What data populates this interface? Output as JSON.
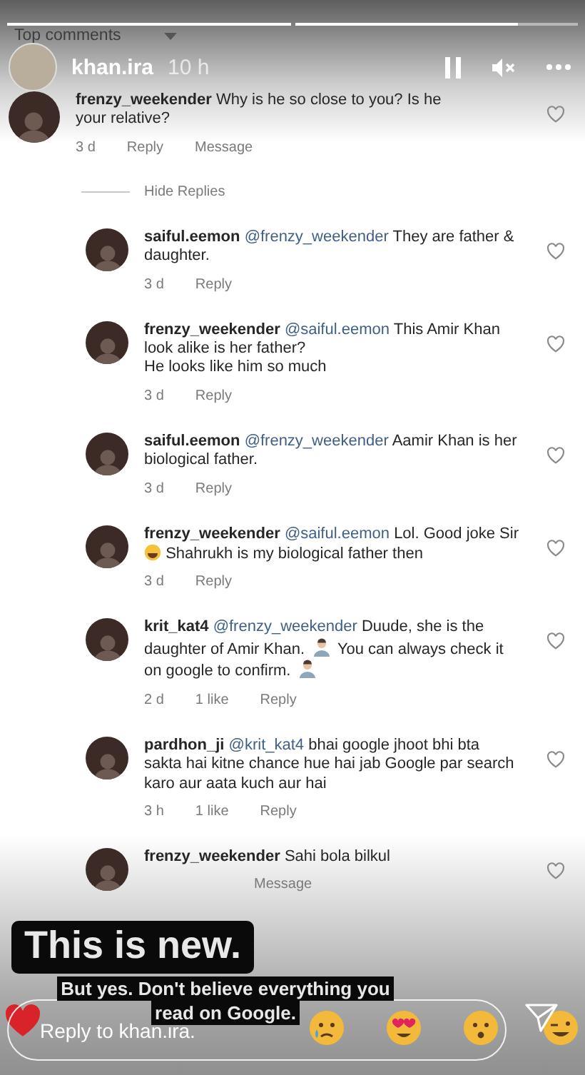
{
  "progress": [
    {
      "level": 1
    },
    {
      "level": 0.79
    }
  ],
  "sort": {
    "label": "Top comments"
  },
  "story": {
    "username": "khan.ira",
    "time": "10 h"
  },
  "comment": {
    "username": "frenzy_weekender",
    "segments": [
      {
        "kind": "text",
        "text": "Why is he so close to you? Is he your relative?"
      }
    ],
    "meta": [
      "3 d",
      "Reply",
      "Message"
    ]
  },
  "hide_replies": "Hide Replies",
  "replies": [
    {
      "username": "saiful.eemon",
      "mention": "@frenzy_weekender",
      "segments": [
        {
          "kind": "text",
          "text": "They are father & daughter."
        }
      ],
      "meta": [
        "3 d",
        "Reply"
      ]
    },
    {
      "username": "frenzy_weekender",
      "mention": "@saiful.eemon",
      "segments": [
        {
          "kind": "text",
          "text": "This Amir Khan look alike is her father?"
        },
        {
          "kind": "break"
        },
        {
          "kind": "text",
          "text": "He looks like him so much"
        }
      ],
      "meta": [
        "3 d",
        "Reply"
      ]
    },
    {
      "username": "saiful.eemon",
      "mention": "@frenzy_weekender",
      "segments": [
        {
          "kind": "text",
          "text": "Aamir Khan is her biological father."
        }
      ],
      "meta": [
        "3 d",
        "Reply"
      ]
    },
    {
      "username": "frenzy_weekender",
      "mention": "@saiful.eemon",
      "segments": [
        {
          "kind": "text",
          "text": "Lol. Good joke Sir"
        },
        {
          "kind": "laugh-emoji"
        },
        {
          "kind": "text",
          "text": "Shahrukh is my biological father then"
        }
      ],
      "meta": [
        "3 d",
        "Reply"
      ]
    },
    {
      "username": "krit_kat4",
      "mention": "@frenzy_weekender",
      "segments": [
        {
          "kind": "text",
          "text": "Duude, she is the daughter of Amir Khan."
        },
        {
          "kind": "person-emoji"
        },
        {
          "kind": "text",
          "text": "You can always check it on google to confirm."
        },
        {
          "kind": "person-emoji"
        }
      ],
      "meta": [
        "2 d",
        "1 like",
        "Reply"
      ]
    },
    {
      "username": "pardhon_ji",
      "mention": "@krit_kat4",
      "segments": [
        {
          "kind": "text",
          "text": "bhai google jhoot bhi bta sakta hai kitne chance hue hai jab Google par search karo aur aata kuch aur hai"
        }
      ],
      "meta": [
        "3 h",
        "1 like",
        "Reply"
      ]
    },
    {
      "username": "frenzy_weekender",
      "segments": [
        {
          "kind": "text",
          "text": "Sahi bola bilkul"
        }
      ],
      "meta": [
        "Message"
      ],
      "covered": true
    }
  ],
  "overlay": {
    "headline": "This is new.",
    "caption_lines": [
      "But yes. Don't believe everything you",
      "read on Google."
    ]
  },
  "reply_bar": {
    "placeholder": "Reply to khan.ira."
  }
}
